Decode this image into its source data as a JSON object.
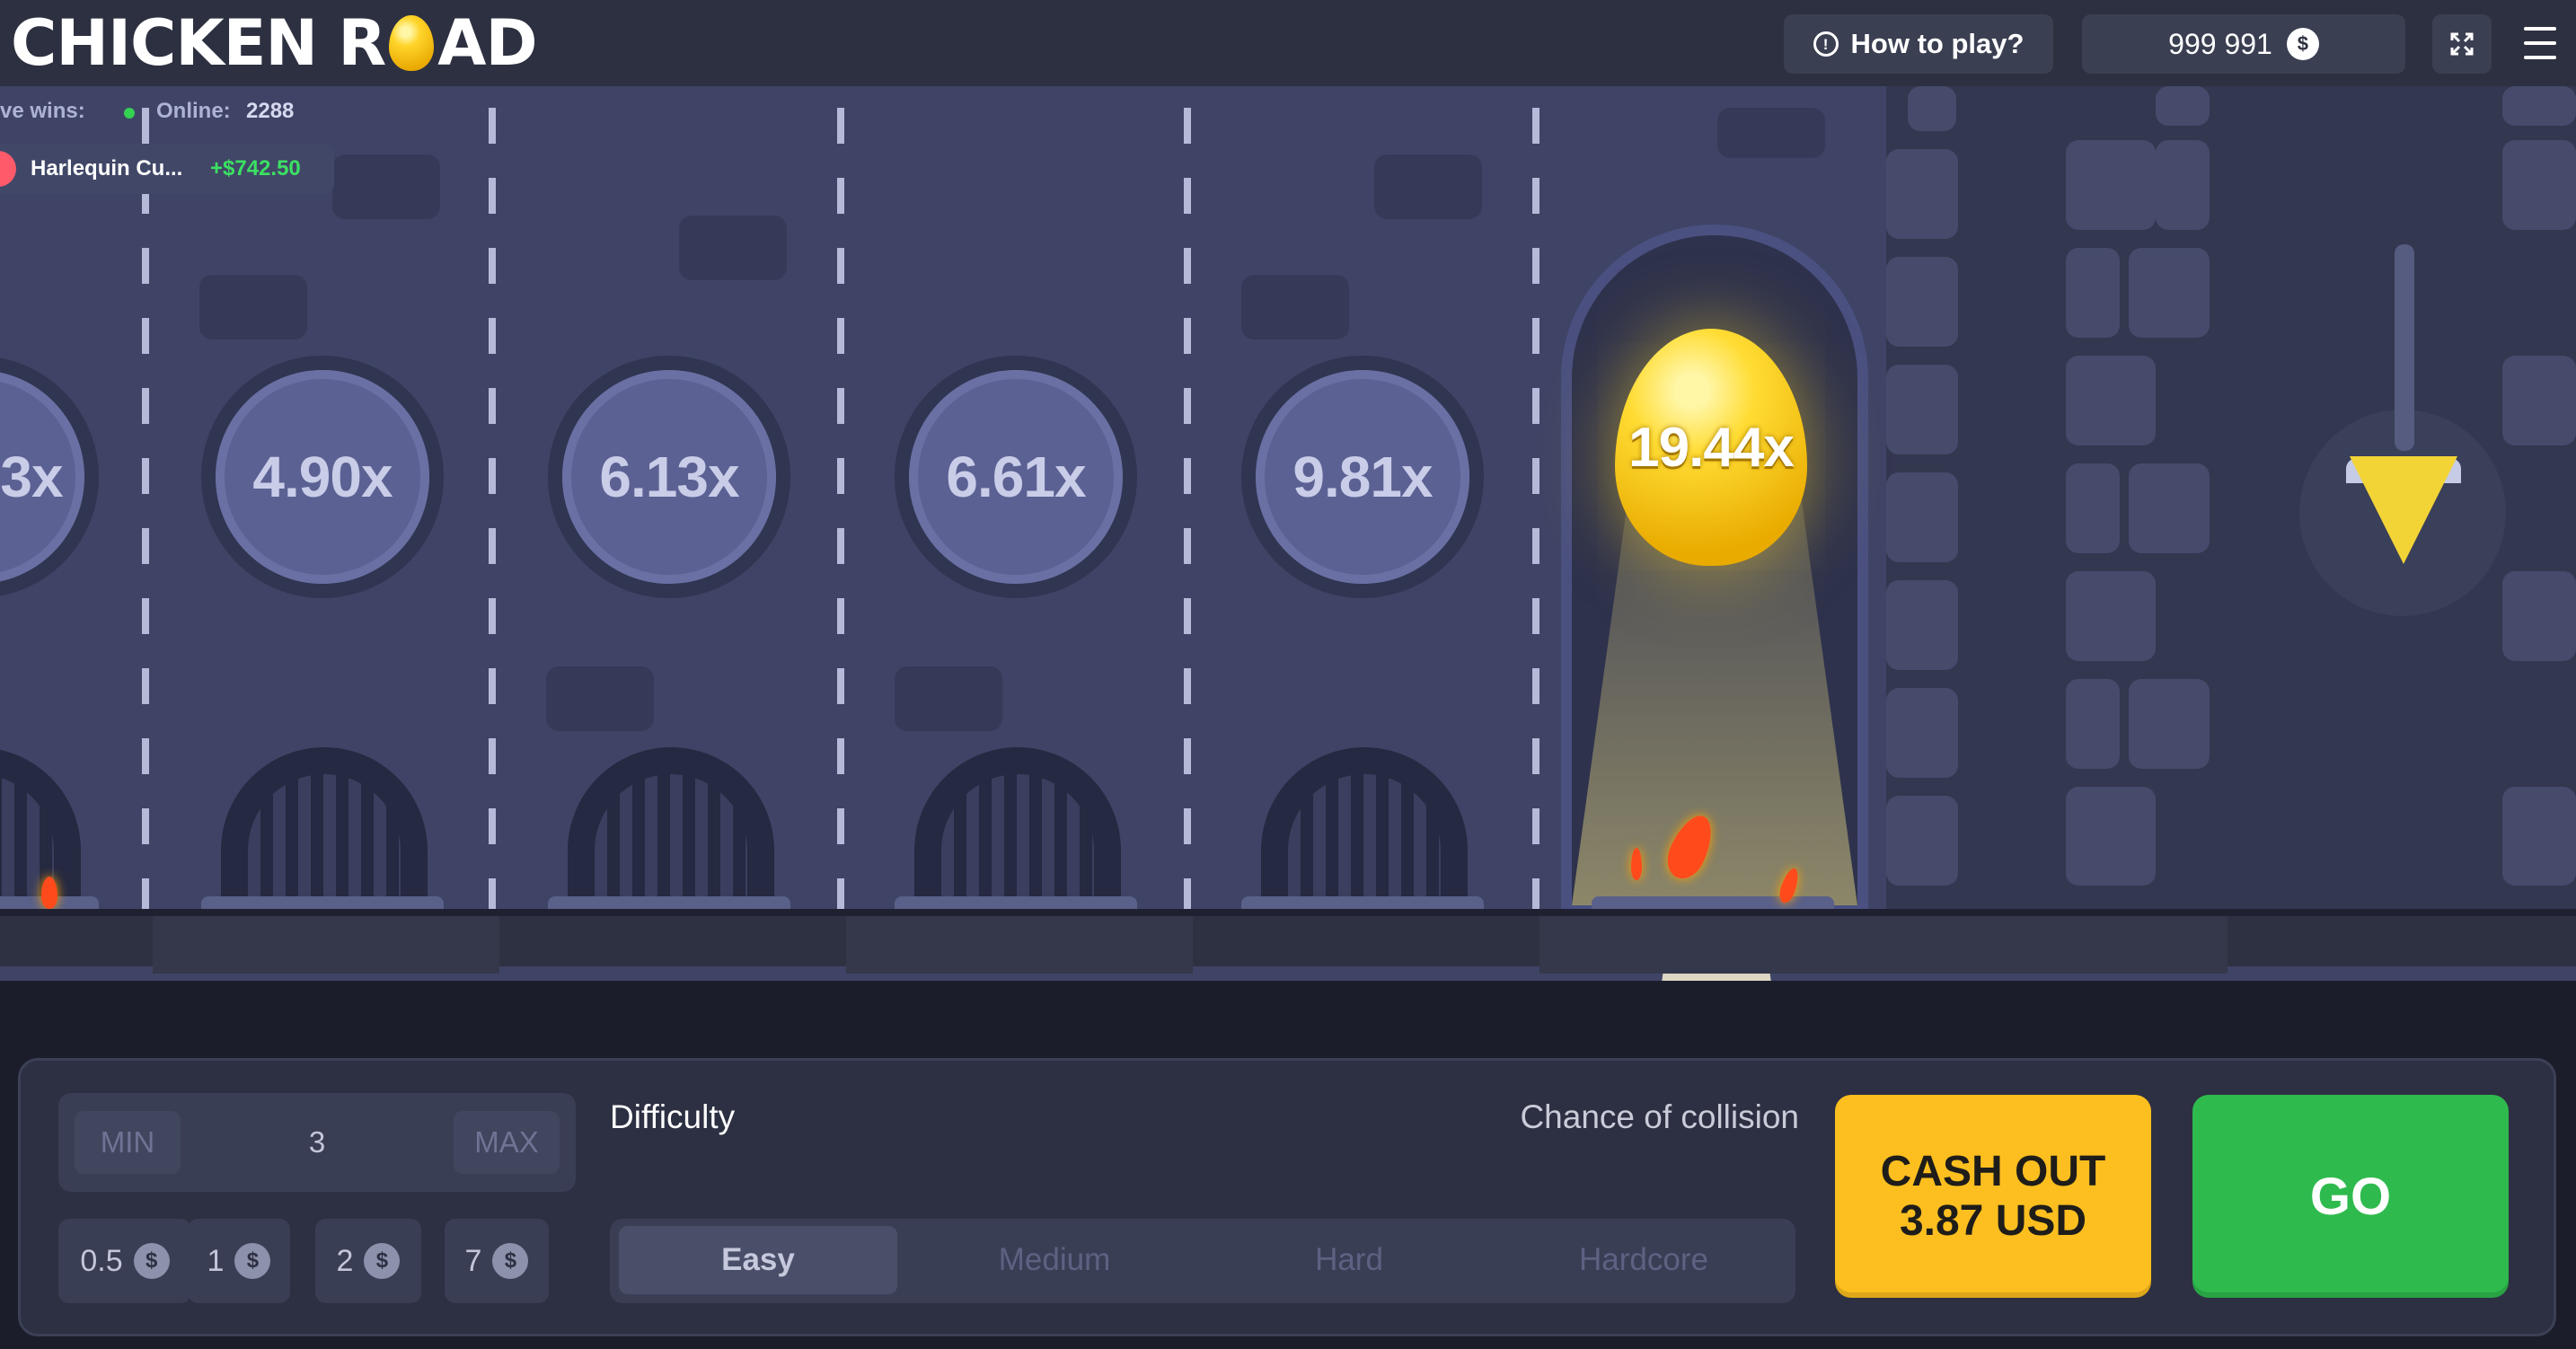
{
  "header": {
    "logo_left": "CHICKEN R",
    "logo_right": "AD",
    "how_to_play": "How to play?",
    "balance": "999 991",
    "currency_symbol": "$"
  },
  "live": {
    "live_wins_label": "ve wins:",
    "online_label": "Online:",
    "online_count": "2288",
    "latest_win": {
      "name": "Harlequin Cu...",
      "amount": "+$742.50"
    }
  },
  "lanes": {
    "partial_multiplier": "3x",
    "multipliers": [
      "4.90x",
      "6.13x",
      "6.61x",
      "9.81x"
    ],
    "highlight_multiplier": "19.44x"
  },
  "controls": {
    "min_label": "MIN",
    "bet_value": "3",
    "max_label": "MAX",
    "chips": [
      "0.5",
      "1",
      "2",
      "7"
    ],
    "chip_symbol": "$",
    "difficulty_label": "Difficulty",
    "collision_label": "Chance of collision",
    "difficulties": [
      "Easy",
      "Medium",
      "Hard",
      "Hardcore"
    ],
    "active_difficulty": "Easy",
    "cashout_line1": "CASH OUT",
    "cashout_line2": "3.87 USD",
    "go_label": "GO"
  },
  "colors": {
    "accent_yellow": "#fcbf1f",
    "go_green": "#2fba4e",
    "win_green": "#3ce062",
    "game_bg": "#3f4466"
  }
}
